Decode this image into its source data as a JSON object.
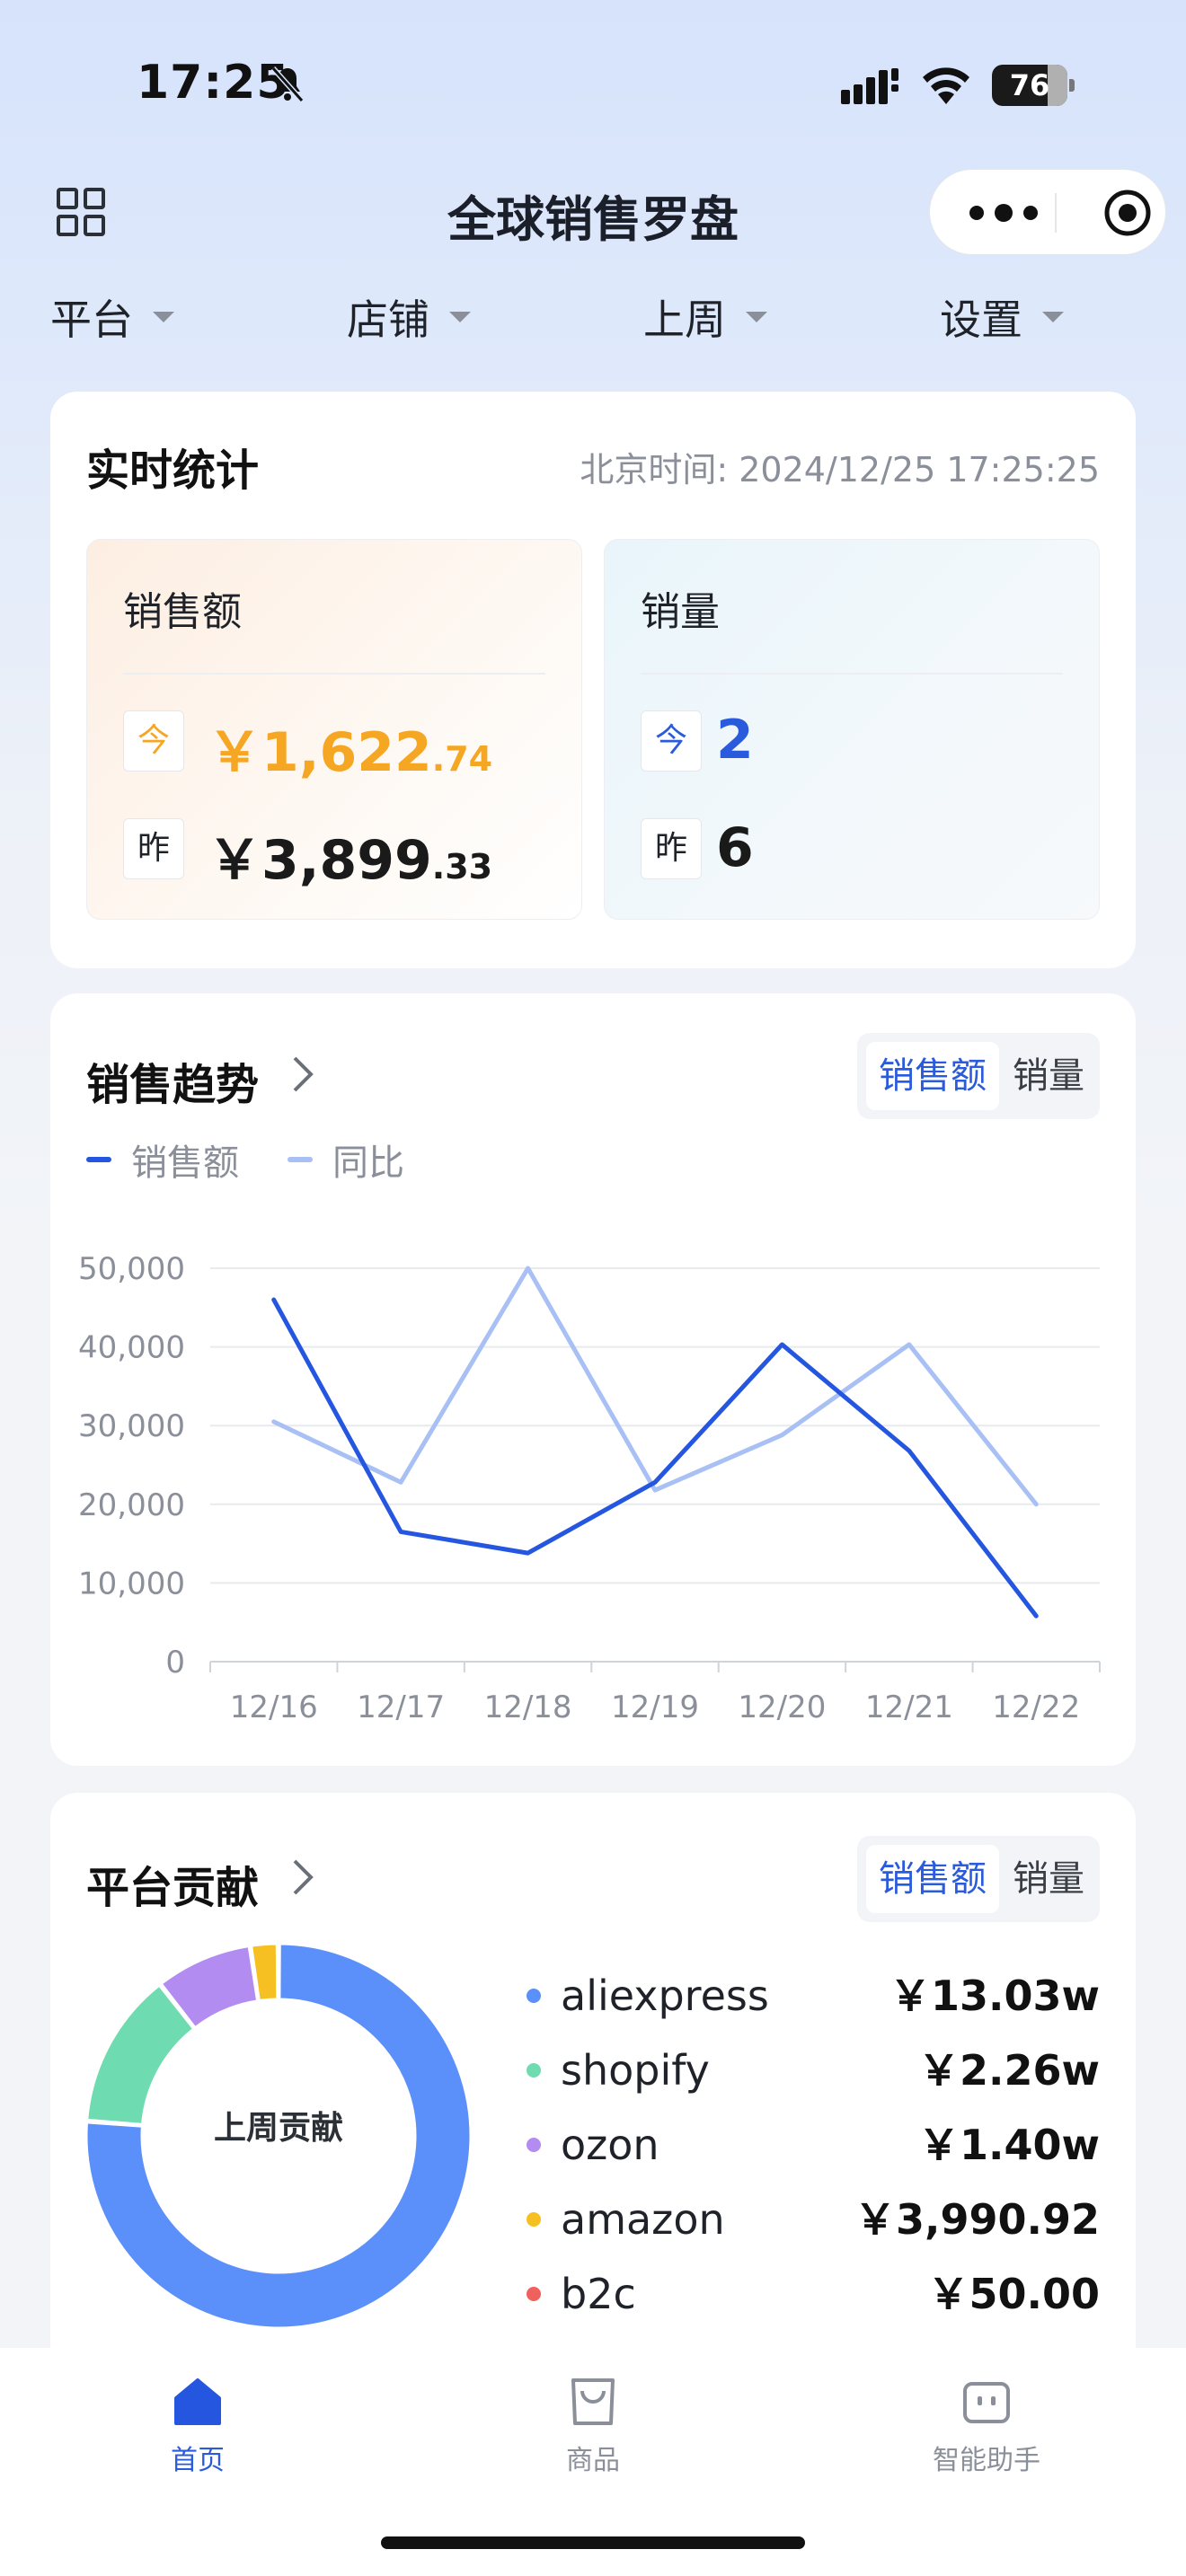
{
  "status_bar": {
    "time": "17:25",
    "battery": "76"
  },
  "nav": {
    "title": "全球销售罗盘"
  },
  "filters": [
    {
      "label": "平台"
    },
    {
      "label": "店铺"
    },
    {
      "label": "上周"
    },
    {
      "label": "设置"
    }
  ],
  "realtime": {
    "title": "实时统计",
    "timestamp": "北京时间: 2024/12/25 17:25:25",
    "sales": {
      "label": "销售额",
      "today_tag": "今",
      "today_int": "￥1,622",
      "today_dec": ".74",
      "yest_tag": "昨",
      "yest_int": "￥3,899",
      "yest_dec": ".33"
    },
    "volume": {
      "label": "销量",
      "today_tag": "今",
      "today": "2",
      "yest_tag": "昨",
      "yest": "6"
    }
  },
  "trend": {
    "title": "销售趋势",
    "toggle": {
      "active": "销售额",
      "other": "销量"
    },
    "legend": [
      {
        "name": "销售额",
        "color": "#2456e0"
      },
      {
        "name": "同比",
        "color": "#a9c0f5"
      }
    ]
  },
  "chart_data": {
    "type": "line",
    "x": [
      "12/16",
      "12/17",
      "12/18",
      "12/19",
      "12/20",
      "12/21",
      "12/22"
    ],
    "series": [
      {
        "name": "销售额",
        "color": "#2456e0",
        "values": [
          46000,
          16500,
          13800,
          22800,
          40300,
          26800,
          5800
        ]
      },
      {
        "name": "同比",
        "color": "#a9c0f5",
        "values": [
          30500,
          22800,
          50000,
          21800,
          28800,
          40300,
          20000
        ]
      }
    ],
    "ylim": [
      0,
      50000
    ],
    "yticks": [
      "0",
      "10,000",
      "20,000",
      "30,000",
      "40,000",
      "50,000"
    ],
    "grid": true
  },
  "platform": {
    "title": "平台贡献",
    "toggle": {
      "active": "销售额",
      "other": "销量"
    },
    "donut_label": "上周贡献",
    "items": [
      {
        "name": "aliexpress",
        "value": "￥13.03w",
        "color": "#5b8ff9",
        "share": 0.7415
      },
      {
        "name": "shopify",
        "value": "￥2.26w",
        "color": "#6fdbb1",
        "share": 0.1286
      },
      {
        "name": "ozon",
        "value": "￥1.40w",
        "color": "#b38cf2",
        "share": 0.0797
      },
      {
        "name": "amazon",
        "value": "￥3,990.92",
        "color": "#f6c022",
        "share": 0.0227
      },
      {
        "name": "b2c",
        "value": "￥50.00",
        "color": "#f0605d",
        "share": 0.0003
      }
    ]
  },
  "tabbar": [
    {
      "label": "首页",
      "active": true
    },
    {
      "label": "商品",
      "active": false
    },
    {
      "label": "智能助手",
      "active": false
    }
  ]
}
